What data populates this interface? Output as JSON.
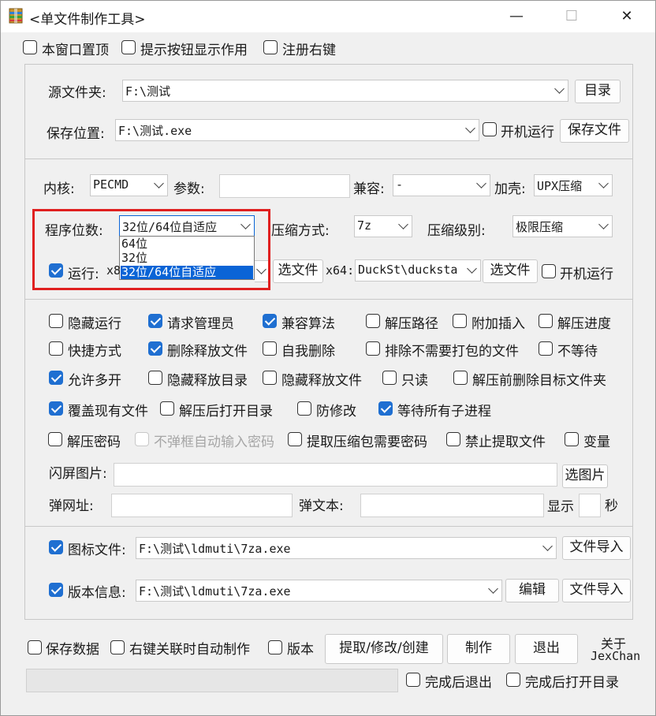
{
  "window": {
    "title": "<单文件制作工具>",
    "minimize": "—",
    "maximize": "☐",
    "close": "✕"
  },
  "top_options": {
    "topmost": {
      "label": "本窗口置顶",
      "checked": false
    },
    "show_tips": {
      "label": "提示按钮显示作用",
      "checked": false
    },
    "register_context": {
      "label": "注册右键",
      "checked": false
    }
  },
  "source": {
    "source_folder_label": "源文件夹:",
    "source_folder_value": "F:\\测试",
    "dir_button": "目录",
    "save_location_label": "保存位置:",
    "save_location_value": "F:\\测试.exe",
    "startup_run": {
      "label": "开机运行",
      "checked": false
    },
    "save_file_button": "保存文件"
  },
  "config": {
    "kernel_label": "内核:",
    "kernel_value": "PECMD",
    "params_label": "参数:",
    "params_value": "",
    "compat_label": "兼容:",
    "compat_value": "-",
    "shell_label": "加壳:",
    "shell_value": "UPX压缩",
    "bits_label": "程序位数:",
    "bits_value": "32位/64位自适应",
    "bits_options": [
      "64位",
      "32位",
      "32位/64位自适应"
    ],
    "compress_label": "压缩方式:",
    "compress_value": "7z",
    "level_label": "压缩级别:",
    "level_value": "极限压缩",
    "run_checkbox": {
      "label": "运行:",
      "checked": true
    },
    "x86_prefix": "x8",
    "select_file_1": "选文件",
    "x64_label": "x64:",
    "x64_value": "DuckSt\\ducksta",
    "select_file_2": "选文件",
    "startup_run_2": {
      "label": "开机运行",
      "checked": false
    }
  },
  "options": [
    {
      "label": "隐藏运行",
      "checked": false
    },
    {
      "label": "请求管理员",
      "checked": true
    },
    {
      "label": "兼容算法",
      "checked": true
    },
    {
      "label": "解压路径",
      "checked": false
    },
    {
      "label": "附加插入",
      "checked": false
    },
    {
      "label": "解压进度",
      "checked": false
    },
    {
      "label": "快捷方式",
      "checked": false
    },
    {
      "label": "删除释放文件",
      "checked": true
    },
    {
      "label": "自我删除",
      "checked": false
    },
    {
      "label": "排除不需要打包的文件",
      "checked": false
    },
    {
      "label": "不等待",
      "checked": false
    },
    {
      "label": "允许多开",
      "checked": true
    },
    {
      "label": "隐藏释放目录",
      "checked": false
    },
    {
      "label": "隐藏释放文件",
      "checked": false
    },
    {
      "label": "只读",
      "checked": false
    },
    {
      "label": "解压前删除目标文件夹",
      "checked": false
    },
    {
      "label": "覆盖现有文件",
      "checked": true
    },
    {
      "label": "解压后打开目录",
      "checked": false
    },
    {
      "label": "防修改",
      "checked": false
    },
    {
      "label": "等待所有子进程",
      "checked": true
    },
    {
      "label": "解压密码",
      "checked": false
    },
    {
      "label": "不弹框自动输入密码",
      "checked": false,
      "disabled": true
    },
    {
      "label": "提取压缩包需要密码",
      "checked": false
    },
    {
      "label": "禁止提取文件",
      "checked": false
    },
    {
      "label": "变量",
      "checked": false
    }
  ],
  "splash": {
    "label": "闪屏图片:",
    "value": "",
    "button": "选图片",
    "url_label": "弹网址:",
    "url_value": "",
    "text_label": "弹文本:",
    "text_value": "",
    "show_label": "显示",
    "seconds_value": "",
    "seconds_label": "秒"
  },
  "icon": {
    "icon_checkbox": {
      "label": "图标文件:",
      "checked": true
    },
    "icon_value": "F:\\测试\\ldmuti\\7za.exe",
    "icon_import": "文件导入",
    "version_checkbox": {
      "label": "版本信息:",
      "checked": true
    },
    "version_value": "F:\\测试\\ldmuti\\7za.exe",
    "edit_button": "编辑",
    "version_import": "文件导入"
  },
  "bottom": {
    "save_data": {
      "label": "保存数据",
      "checked": false
    },
    "auto_make": {
      "label": "右键关联时自动制作",
      "checked": false
    },
    "version": {
      "label": "版本",
      "checked": false
    },
    "extract_button": "提取/修改/创建",
    "make_button": "制作",
    "exit_button": "退出",
    "about_line1": "关于",
    "about_line2": "JexChan",
    "exit_after": {
      "label": "完成后退出",
      "checked": false
    },
    "open_after": {
      "label": "完成后打开目录",
      "checked": false
    }
  }
}
